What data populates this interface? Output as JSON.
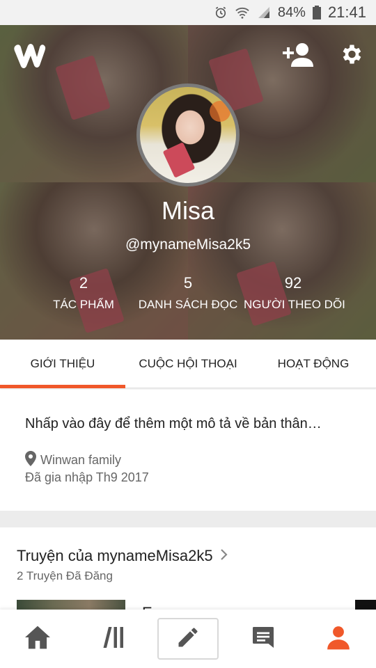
{
  "status_bar": {
    "battery": "84%",
    "time": "21:41",
    "icons": [
      "alarm-icon",
      "wifi-icon",
      "signal-icon",
      "battery-icon"
    ]
  },
  "header": {
    "icons": [
      "wattpad-logo-icon",
      "add-user-icon",
      "gear-icon"
    ],
    "display_name": "Misa",
    "username": "@mynameMisa2k5"
  },
  "stats": [
    {
      "value": "2",
      "label": "TÁC PHẨM"
    },
    {
      "value": "5",
      "label": "DANH SÁCH ĐỌC"
    },
    {
      "value": "92",
      "label": "NGƯỜI THEO DÕI"
    }
  ],
  "tabs": [
    {
      "label": "GIỚI THIỆU",
      "active": true
    },
    {
      "label": "CUỘC HỘI THOẠI",
      "active": false
    },
    {
      "label": "HOẠT ĐỘNG",
      "active": false
    }
  ],
  "about": {
    "description_placeholder": "Nhấp vào đây để thêm một mô tả về bản thân…",
    "location": "Winwan family",
    "joined": "Đã gia nhập Th9 2017"
  },
  "stories": {
    "title": "Truyện của mynameMisa2k5",
    "count": "2 Truyện Đã Đăng",
    "first_title_partial": "E..."
  },
  "bottom_nav": {
    "items": [
      "home-icon",
      "library-icon",
      "pencil-icon",
      "messages-icon",
      "profile-icon"
    ],
    "active_index": 4
  },
  "colors": {
    "accent": "#f0582a",
    "text": "#222222",
    "muted": "#666666",
    "nav_icon": "#555555"
  }
}
